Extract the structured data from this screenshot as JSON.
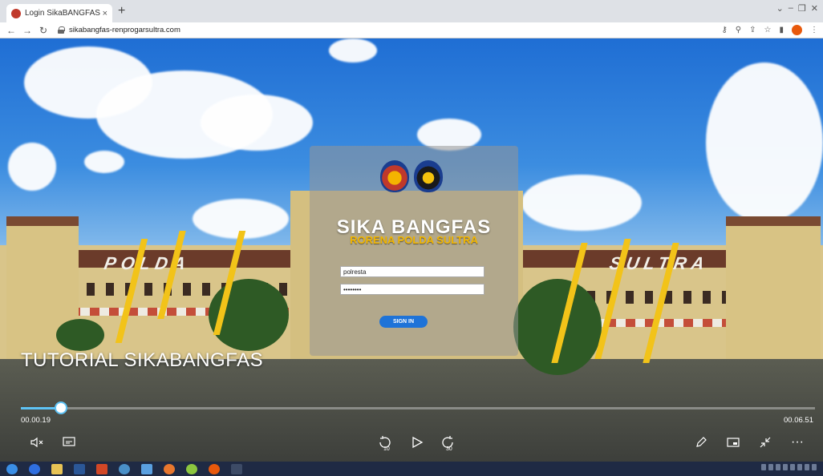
{
  "browser": {
    "tab_title": "Login SikaBANGFAS",
    "tab_close": "×",
    "new_tab": "+",
    "url": "sikabangfas-renprogarsultra.com"
  },
  "scene": {
    "roof_left": "POLDA",
    "roof_right": "SULTRA"
  },
  "login": {
    "title": "SIKA BANGFAS",
    "subtitle": "RORENA POLDA SULTRA",
    "username_value": "polresta",
    "password_value": "••••••••",
    "signin_label": "SIGN IN"
  },
  "video": {
    "title": "TUTORIAL SIKABANGFAS",
    "current_time": "00.00.19",
    "duration": "00.06.51",
    "progress_fraction": 0.05,
    "skip_back_label": "10",
    "skip_forward_label": "30"
  },
  "icons": {
    "back": "back-arrow-icon",
    "forward": "forward-arrow-icon",
    "reload": "reload-icon",
    "mute": "mute-icon",
    "captions": "captions-icon",
    "play": "play-icon",
    "edit": "pen-icon",
    "miniplayer": "miniplayer-icon",
    "collapse": "collapse-icon",
    "more": "more-icon"
  },
  "colors": {
    "accent": "#5ec3f5",
    "signin": "#1e73d8",
    "subtitle": "#f2b600"
  }
}
